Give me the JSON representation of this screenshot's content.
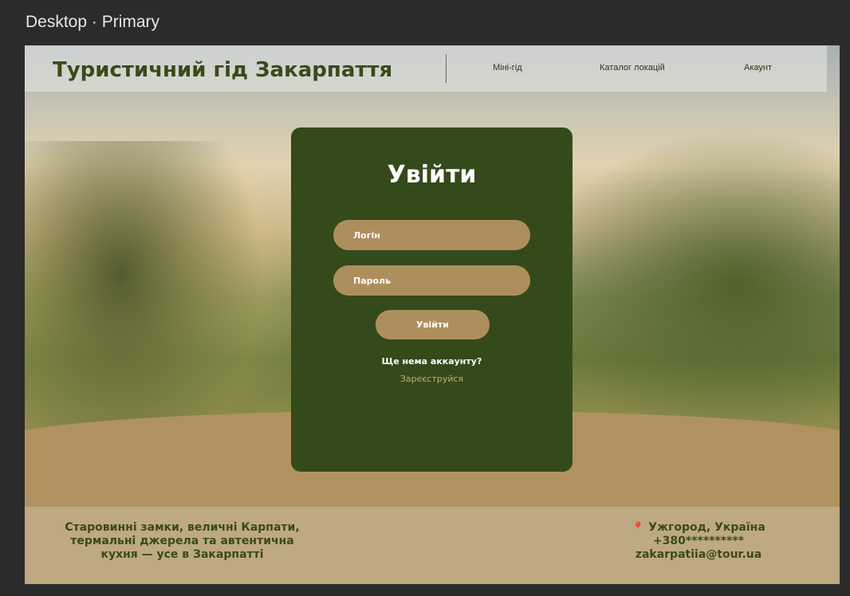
{
  "frame": {
    "label": "Desktop · Primary"
  },
  "header": {
    "brand": "Туристичний гід Закарпаття",
    "nav": [
      "Міні-гід",
      "Каталог локацій",
      "Акаунт"
    ]
  },
  "login": {
    "title": "Увійти",
    "login_placeholder": "Логін",
    "password_placeholder": "Пароль",
    "submit_label": "Увійти",
    "no_account_text": "Ще нема аккаунту?",
    "register_label": "Зареєструйся"
  },
  "footer": {
    "tagline_lines": [
      "Старовинні замки, величні Карпати,",
      "термальні джерела та автентична",
      "кухня — усе в Закарпатті"
    ],
    "location": "Ужгород, Україна",
    "phone": "+380**********",
    "email": "zakarpatiia@tour.ua"
  },
  "colors": {
    "card": "#354a1a",
    "field": "#ad8f5d",
    "brand_text": "#3a4a18",
    "footer": "#bea983",
    "register_link": "#c9a970"
  },
  "icons": {
    "location": "map-pin-icon"
  }
}
